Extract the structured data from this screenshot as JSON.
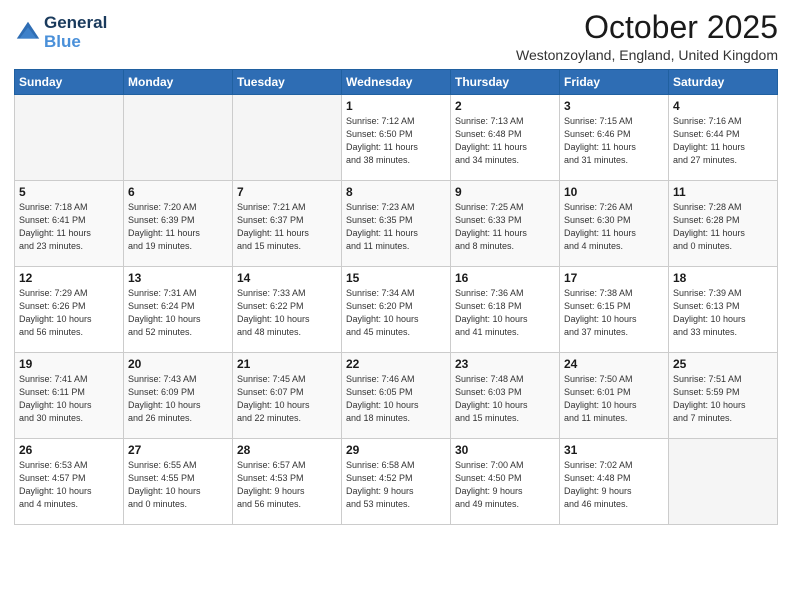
{
  "header": {
    "logo_line1": "General",
    "logo_line2": "Blue",
    "month": "October 2025",
    "location": "Westonzoyland, England, United Kingdom"
  },
  "days_of_week": [
    "Sunday",
    "Monday",
    "Tuesday",
    "Wednesday",
    "Thursday",
    "Friday",
    "Saturday"
  ],
  "weeks": [
    [
      {
        "day": "",
        "info": ""
      },
      {
        "day": "",
        "info": ""
      },
      {
        "day": "",
        "info": ""
      },
      {
        "day": "1",
        "info": "Sunrise: 7:12 AM\nSunset: 6:50 PM\nDaylight: 11 hours\nand 38 minutes."
      },
      {
        "day": "2",
        "info": "Sunrise: 7:13 AM\nSunset: 6:48 PM\nDaylight: 11 hours\nand 34 minutes."
      },
      {
        "day": "3",
        "info": "Sunrise: 7:15 AM\nSunset: 6:46 PM\nDaylight: 11 hours\nand 31 minutes."
      },
      {
        "day": "4",
        "info": "Sunrise: 7:16 AM\nSunset: 6:44 PM\nDaylight: 11 hours\nand 27 minutes."
      }
    ],
    [
      {
        "day": "5",
        "info": "Sunrise: 7:18 AM\nSunset: 6:41 PM\nDaylight: 11 hours\nand 23 minutes."
      },
      {
        "day": "6",
        "info": "Sunrise: 7:20 AM\nSunset: 6:39 PM\nDaylight: 11 hours\nand 19 minutes."
      },
      {
        "day": "7",
        "info": "Sunrise: 7:21 AM\nSunset: 6:37 PM\nDaylight: 11 hours\nand 15 minutes."
      },
      {
        "day": "8",
        "info": "Sunrise: 7:23 AM\nSunset: 6:35 PM\nDaylight: 11 hours\nand 11 minutes."
      },
      {
        "day": "9",
        "info": "Sunrise: 7:25 AM\nSunset: 6:33 PM\nDaylight: 11 hours\nand 8 minutes."
      },
      {
        "day": "10",
        "info": "Sunrise: 7:26 AM\nSunset: 6:30 PM\nDaylight: 11 hours\nand 4 minutes."
      },
      {
        "day": "11",
        "info": "Sunrise: 7:28 AM\nSunset: 6:28 PM\nDaylight: 11 hours\nand 0 minutes."
      }
    ],
    [
      {
        "day": "12",
        "info": "Sunrise: 7:29 AM\nSunset: 6:26 PM\nDaylight: 10 hours\nand 56 minutes."
      },
      {
        "day": "13",
        "info": "Sunrise: 7:31 AM\nSunset: 6:24 PM\nDaylight: 10 hours\nand 52 minutes."
      },
      {
        "day": "14",
        "info": "Sunrise: 7:33 AM\nSunset: 6:22 PM\nDaylight: 10 hours\nand 48 minutes."
      },
      {
        "day": "15",
        "info": "Sunrise: 7:34 AM\nSunset: 6:20 PM\nDaylight: 10 hours\nand 45 minutes."
      },
      {
        "day": "16",
        "info": "Sunrise: 7:36 AM\nSunset: 6:18 PM\nDaylight: 10 hours\nand 41 minutes."
      },
      {
        "day": "17",
        "info": "Sunrise: 7:38 AM\nSunset: 6:15 PM\nDaylight: 10 hours\nand 37 minutes."
      },
      {
        "day": "18",
        "info": "Sunrise: 7:39 AM\nSunset: 6:13 PM\nDaylight: 10 hours\nand 33 minutes."
      }
    ],
    [
      {
        "day": "19",
        "info": "Sunrise: 7:41 AM\nSunset: 6:11 PM\nDaylight: 10 hours\nand 30 minutes."
      },
      {
        "day": "20",
        "info": "Sunrise: 7:43 AM\nSunset: 6:09 PM\nDaylight: 10 hours\nand 26 minutes."
      },
      {
        "day": "21",
        "info": "Sunrise: 7:45 AM\nSunset: 6:07 PM\nDaylight: 10 hours\nand 22 minutes."
      },
      {
        "day": "22",
        "info": "Sunrise: 7:46 AM\nSunset: 6:05 PM\nDaylight: 10 hours\nand 18 minutes."
      },
      {
        "day": "23",
        "info": "Sunrise: 7:48 AM\nSunset: 6:03 PM\nDaylight: 10 hours\nand 15 minutes."
      },
      {
        "day": "24",
        "info": "Sunrise: 7:50 AM\nSunset: 6:01 PM\nDaylight: 10 hours\nand 11 minutes."
      },
      {
        "day": "25",
        "info": "Sunrise: 7:51 AM\nSunset: 5:59 PM\nDaylight: 10 hours\nand 7 minutes."
      }
    ],
    [
      {
        "day": "26",
        "info": "Sunrise: 6:53 AM\nSunset: 4:57 PM\nDaylight: 10 hours\nand 4 minutes."
      },
      {
        "day": "27",
        "info": "Sunrise: 6:55 AM\nSunset: 4:55 PM\nDaylight: 10 hours\nand 0 minutes."
      },
      {
        "day": "28",
        "info": "Sunrise: 6:57 AM\nSunset: 4:53 PM\nDaylight: 9 hours\nand 56 minutes."
      },
      {
        "day": "29",
        "info": "Sunrise: 6:58 AM\nSunset: 4:52 PM\nDaylight: 9 hours\nand 53 minutes."
      },
      {
        "day": "30",
        "info": "Sunrise: 7:00 AM\nSunset: 4:50 PM\nDaylight: 9 hours\nand 49 minutes."
      },
      {
        "day": "31",
        "info": "Sunrise: 7:02 AM\nSunset: 4:48 PM\nDaylight: 9 hours\nand 46 minutes."
      },
      {
        "day": "",
        "info": ""
      }
    ]
  ]
}
